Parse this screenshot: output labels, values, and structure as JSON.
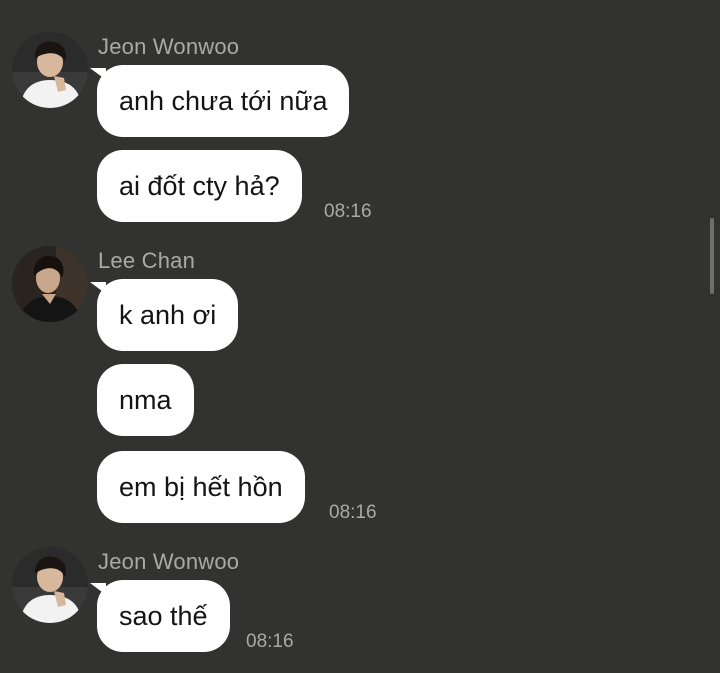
{
  "messages": [
    {
      "sender": "Jeon Wonwoo",
      "avatar_icon": "avatar-jeon-wonwoo",
      "bubbles": [
        "anh chưa tới nữa",
        "ai đốt cty hả?"
      ],
      "time": "08:16"
    },
    {
      "sender": "Lee Chan",
      "avatar_icon": "avatar-lee-chan",
      "bubbles": [
        "k anh ơi",
        "nma",
        "em bị hết hồn"
      ],
      "time": "08:16"
    },
    {
      "sender": "Jeon Wonwoo",
      "avatar_icon": "avatar-jeon-wonwoo",
      "bubbles": [
        "sao thế"
      ],
      "time": "08:16"
    }
  ],
  "colors": {
    "background": "#323330",
    "bubble": "#ffffff",
    "secondary_text": "#a9aaa5"
  }
}
